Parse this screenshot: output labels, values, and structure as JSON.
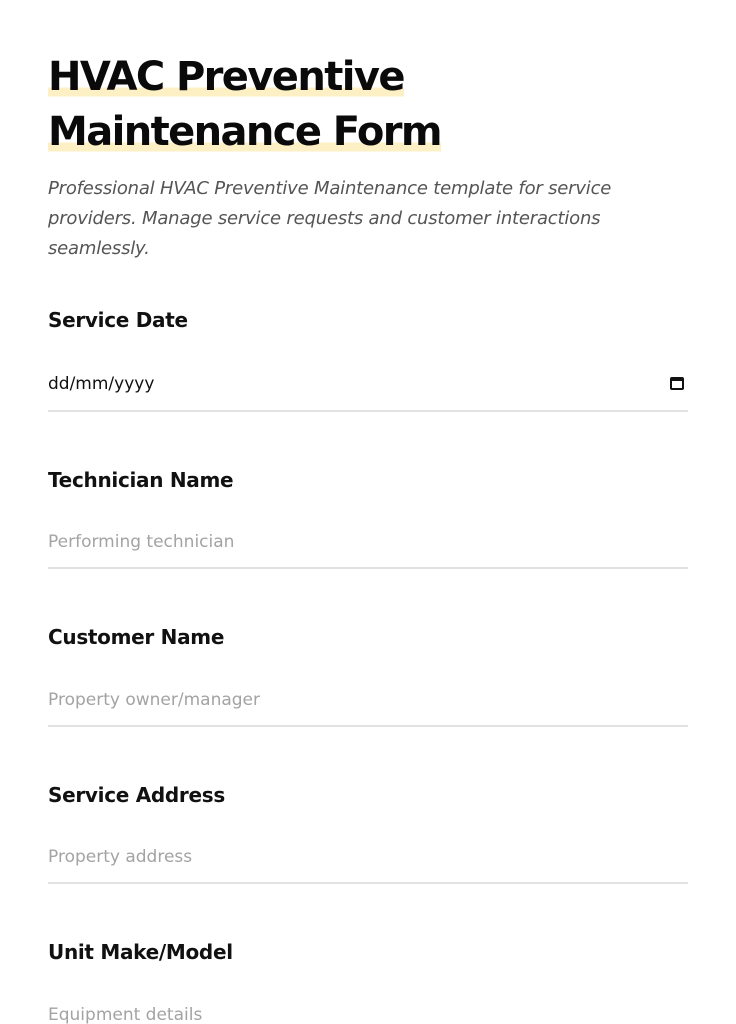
{
  "form": {
    "title": "HVAC Preventive Maintenance Form",
    "description": "Professional HVAC Preventive Maintenance template for service providers. Manage service requests and customer interactions seamlessly.",
    "fields": [
      {
        "label": "Service Date",
        "value": "dd/mm/yyyy",
        "icon": "calendar-icon"
      },
      {
        "label": "Technician Name",
        "placeholder": "Performing technician"
      },
      {
        "label": "Customer Name",
        "placeholder": "Property owner/manager"
      },
      {
        "label": "Service Address",
        "placeholder": "Property address"
      },
      {
        "label": "Unit Make/Model",
        "placeholder": "Equipment details"
      }
    ]
  },
  "colors": {
    "highlight": "#fdf0c4",
    "border": "#e2e2e2",
    "placeholder": "#a3a3a3"
  }
}
